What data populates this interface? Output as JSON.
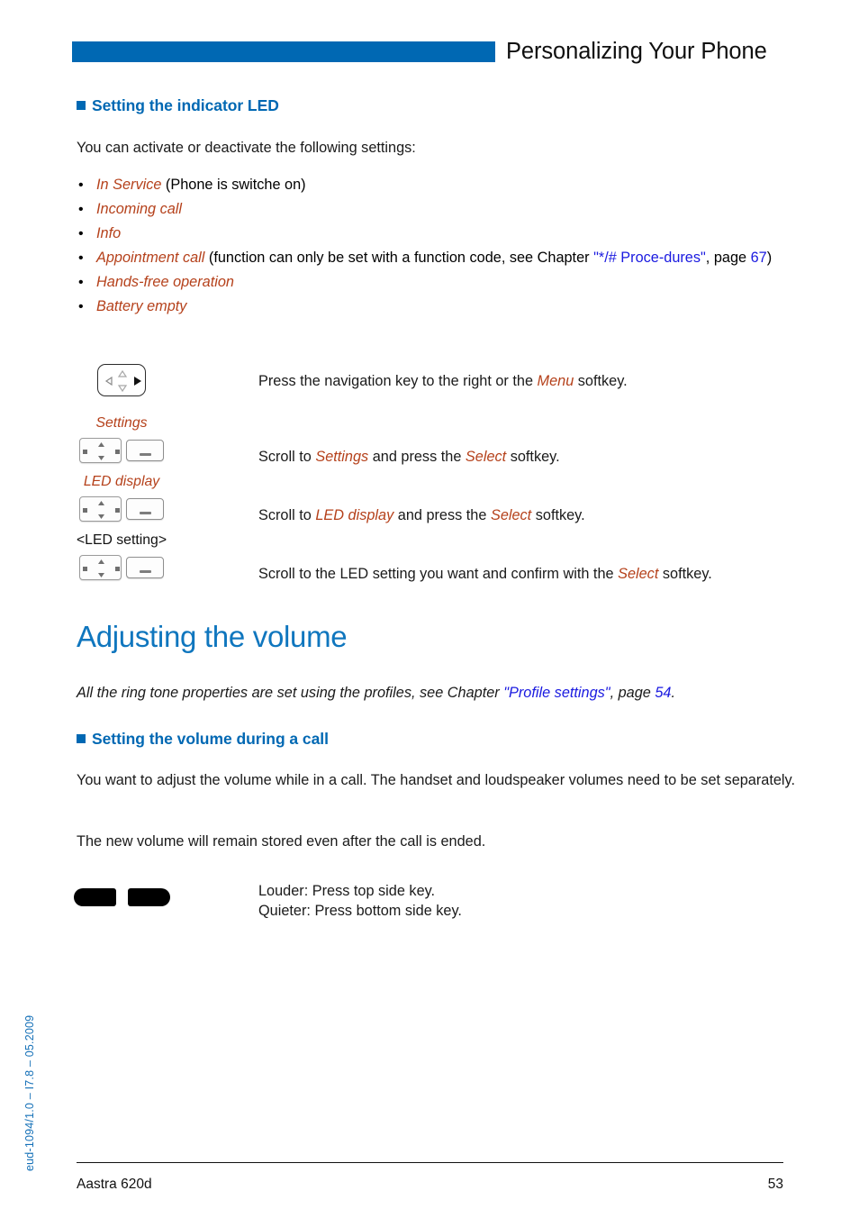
{
  "header": {
    "title": "Personalizing Your Phone",
    "bar_color": "#0068B3"
  },
  "colors": {
    "brand_blue": "#0068B3",
    "heading_blue": "#0F76BE",
    "accent_rust": "#B5411B",
    "link_blue": "#1A1AE0"
  },
  "section_led": {
    "heading": "Setting the indicator LED",
    "intro": "You can activate or deactivate the following settings:",
    "bullets": [
      {
        "term": "In Service",
        "rest": " (Phone is switche on)"
      },
      {
        "term": "Incoming call",
        "rest": ""
      },
      {
        "term": "Info",
        "rest": ""
      },
      {
        "term": "Appointment call",
        "rest": " (function can only be set with a function code, see Chapter ",
        "link": "\"*/# Proce-dures\"",
        "link_part1": "\"*/# Proce-",
        "link_part2": "dures\"",
        "after_link": ", page ",
        "page_ref": "67",
        "tail": ")"
      },
      {
        "term": "Hands-free operation",
        "rest": ""
      },
      {
        "term": "Battery empty",
        "rest": ""
      }
    ],
    "steps": [
      {
        "label": "",
        "icon": "navigation-key",
        "text_parts": [
          {
            "t": "Press the navigation key to the right or the ",
            "s": "plain"
          },
          {
            "t": "Menu",
            "s": "accent"
          },
          {
            "t": " softkey.",
            "s": "plain"
          }
        ]
      },
      {
        "label": "Settings",
        "label_style": "accent",
        "icon": "four-way-key-plus-softkey",
        "text_parts": [
          {
            "t": "Scroll to ",
            "s": "plain"
          },
          {
            "t": "Settings",
            "s": "accent"
          },
          {
            "t": " and press the ",
            "s": "plain"
          },
          {
            "t": "Select",
            "s": "accent"
          },
          {
            "t": "  softkey.",
            "s": "plain"
          }
        ]
      },
      {
        "label": "LED display",
        "label_style": "accent",
        "icon": "four-way-key-plus-softkey",
        "text_parts": [
          {
            "t": "Scroll to ",
            "s": "plain"
          },
          {
            "t": "LED display",
            "s": "accent"
          },
          {
            "t": " and press the ",
            "s": "plain"
          },
          {
            "t": "Select",
            "s": "accent"
          },
          {
            "t": " softkey.",
            "s": "plain"
          }
        ]
      },
      {
        "label": "<LED setting>",
        "label_style": "plain",
        "icon": "four-way-key-plus-softkey",
        "text_parts": [
          {
            "t": "Scroll to the LED setting you want and confirm with the ",
            "s": "plain"
          },
          {
            "t": "Select",
            "s": "accent"
          },
          {
            "t": " softkey.",
            "s": "plain"
          }
        ]
      }
    ]
  },
  "section_volume": {
    "title": "Adjusting the volume",
    "intro_parts": [
      {
        "t": "All the ring tone properties are set using the profiles, see Chapter ",
        "s": "italic"
      },
      {
        "t": "\"Profile settings\"",
        "s": "link-italic"
      },
      {
        "t": ", page ",
        "s": "italic"
      },
      {
        "t": "54",
        "s": "link-italic"
      },
      {
        "t": ".",
        "s": "italic"
      }
    ],
    "subheading": "Setting the volume during a call",
    "paragraph1": "You want to adjust the volume while in a call. The handset and loudspeaker volumes need to be set separately.",
    "paragraph2": "The new volume will remain stored even after the call is ended.",
    "step": {
      "icon": "volume-side-keys",
      "line1": "Louder: Press top side key.",
      "line2": "Quieter: Press bottom side key."
    }
  },
  "side_note": "eud-1094/1.0 – I7.8 – 05.2009",
  "footer": {
    "left": "Aastra 620d",
    "right": "53"
  }
}
